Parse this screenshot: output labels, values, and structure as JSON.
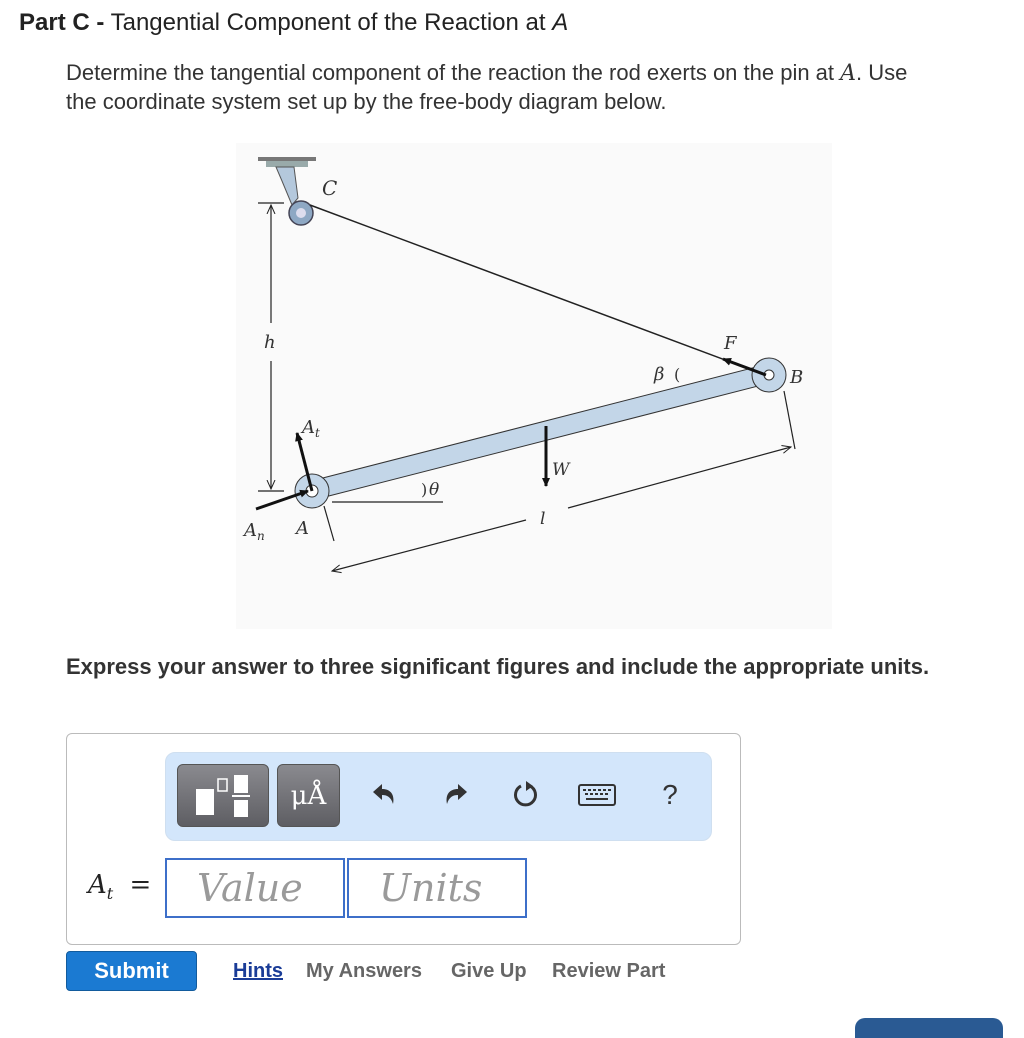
{
  "part": {
    "label": "Part C -",
    "title": "Tangential Component of the Reaction at",
    "title_var": "A"
  },
  "prompt": {
    "line1_a": "Determine the tangential component of the reaction the rod exerts on the pin at ",
    "line1_var": "A",
    "line1_b": ". Use",
    "line2": "the coordinate system set up by the free-body diagram below."
  },
  "figure": {
    "labels": {
      "C": "C",
      "h": "h",
      "F": "F",
      "beta": "β",
      "B": "B",
      "At": "A",
      "At_sub": "t",
      "An": "A",
      "An_sub": "n",
      "A": "A",
      "theta": "θ",
      "W": "W",
      "l": "l"
    },
    "colors": {
      "rod": "#c3d6e8",
      "line": "#222222"
    }
  },
  "instructions": "Express your answer to three significant figures and include the appropriate units.",
  "toolbar": {
    "templates_icon": "templates-icon",
    "units_label": "μÅ",
    "undo_icon": "undo-icon",
    "redo_icon": "redo-icon",
    "reset_icon": "reset-icon",
    "keyboard_icon": "keyboard-icon",
    "help_label": "?"
  },
  "answer": {
    "var": "A",
    "sub": "t",
    "equals": "=",
    "value_placeholder": "Value",
    "units_placeholder": "Units"
  },
  "actions": {
    "submit": "Submit",
    "hints": "Hints",
    "my_answers": "My Answers",
    "give_up": "Give Up",
    "review_part": "Review Part"
  },
  "colors": {
    "submit_bg": "#1b7ad2",
    "toolbar_bg": "#d3e6fb",
    "field_border": "#3d6fc9",
    "hints_link": "#1a3c97"
  }
}
